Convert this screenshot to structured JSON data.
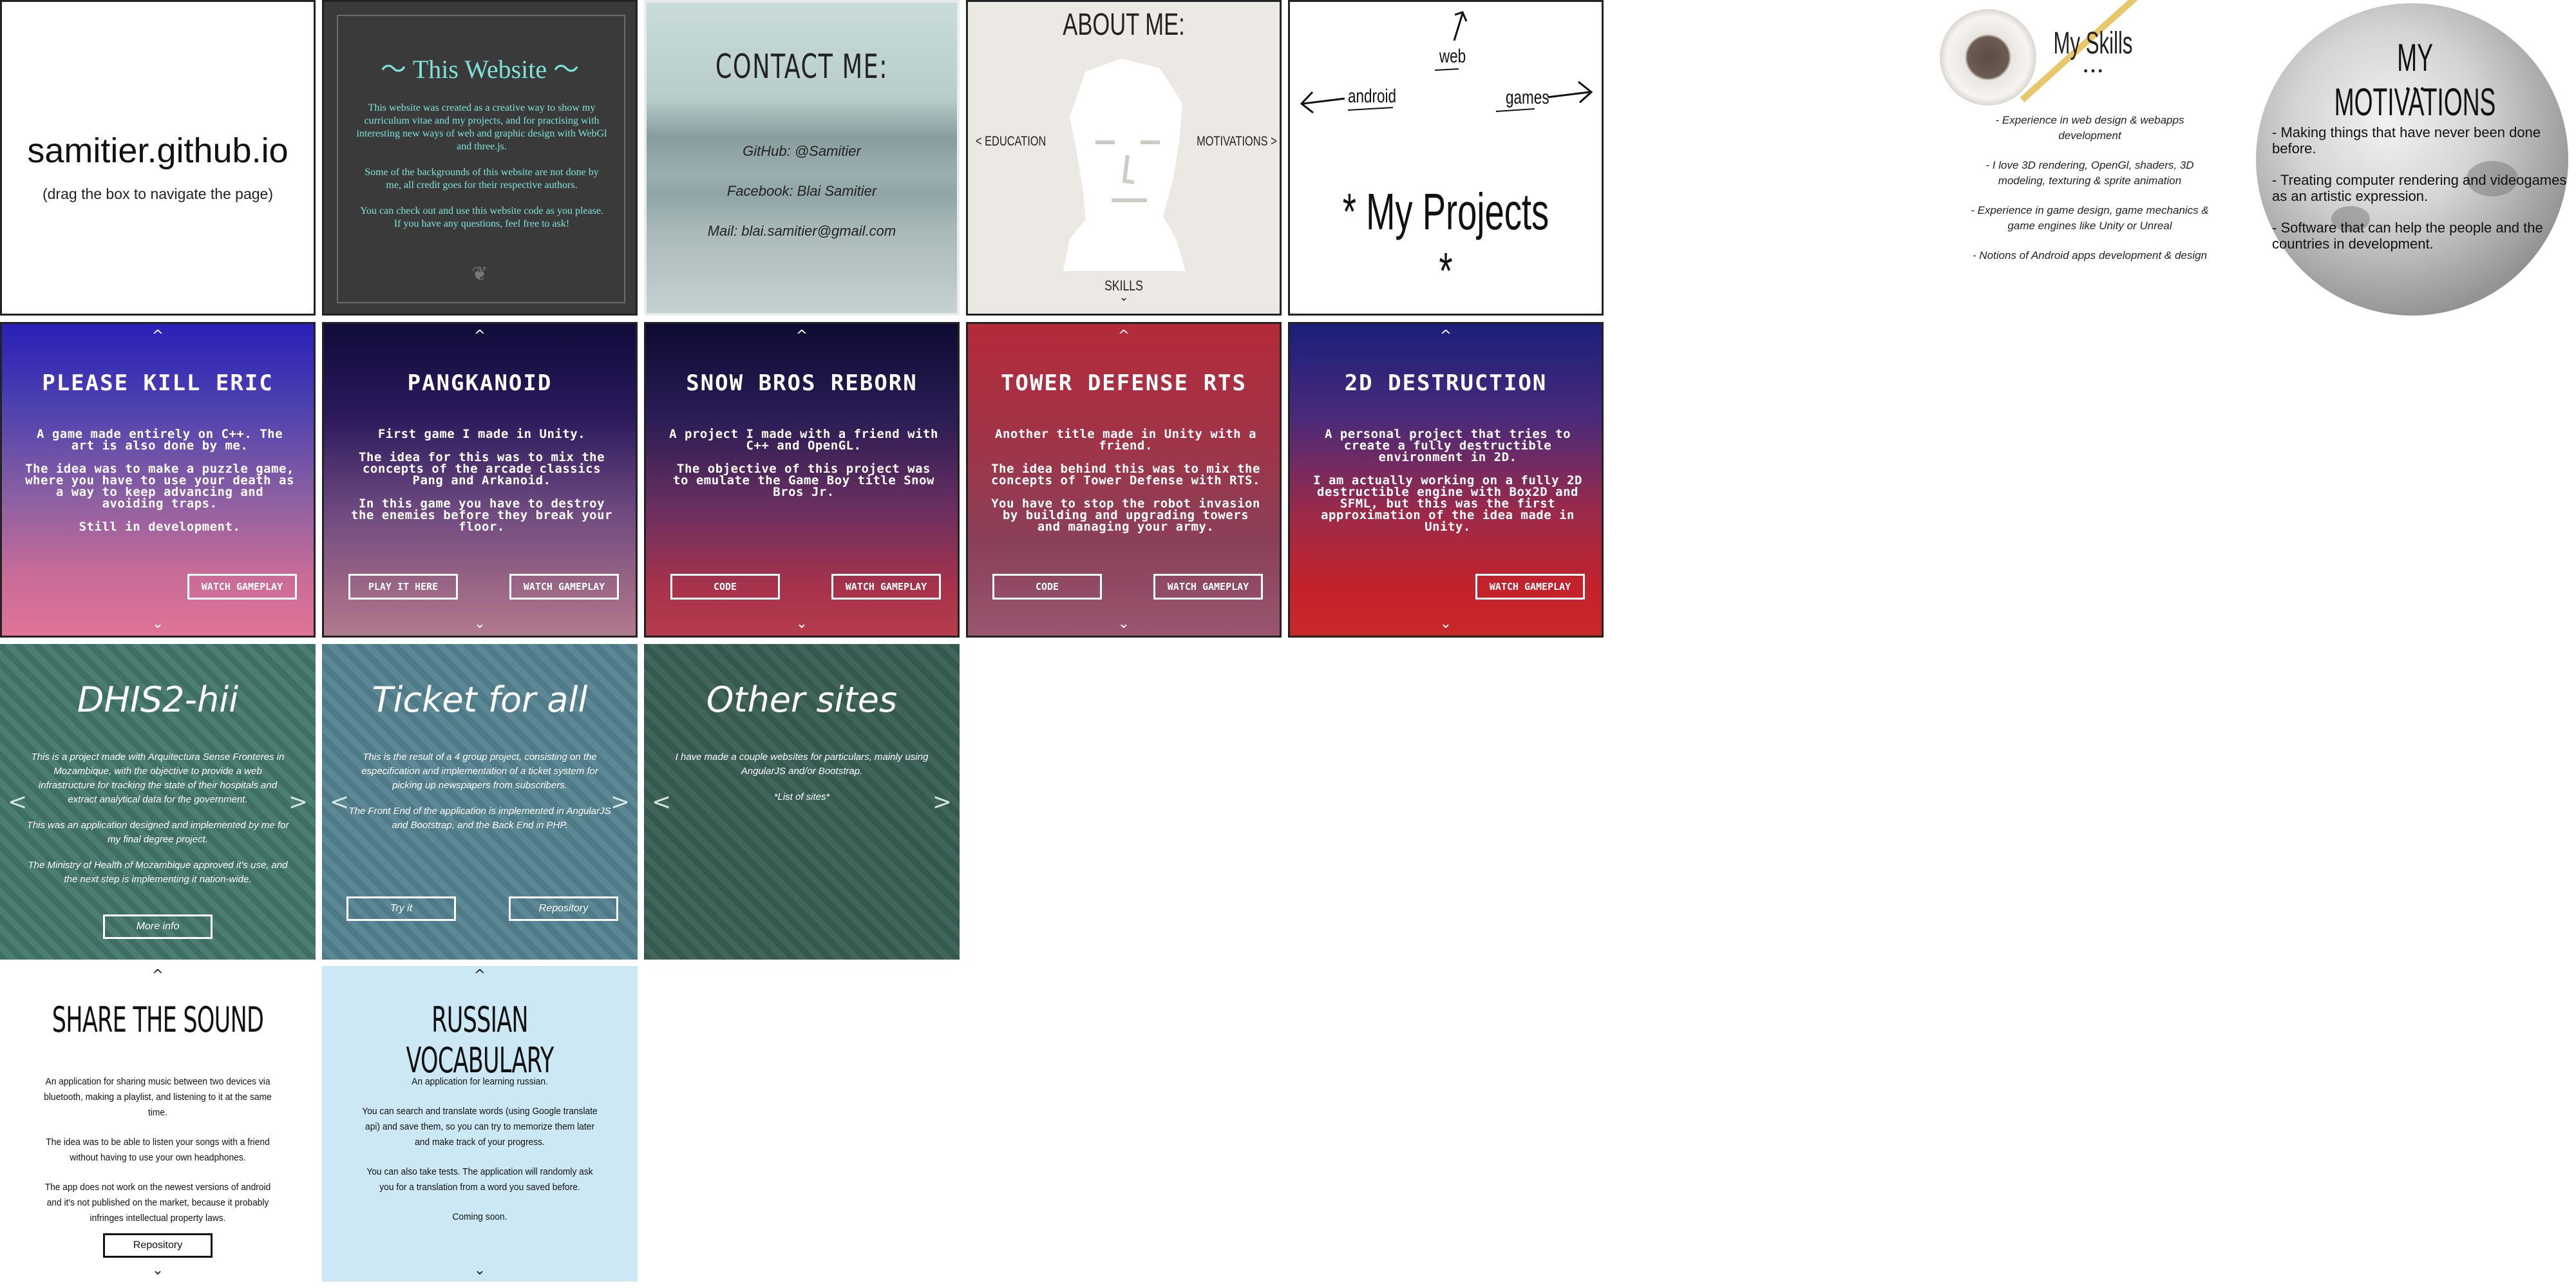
{
  "intro": {
    "title": "samitier.github.io",
    "subtitle": "(drag the box to navigate the page)"
  },
  "this_website": {
    "title": "This Website",
    "paragraphs": [
      "This website was created as a creative way to show my curriculum vitae and my projects, and for practising with interesting new ways of web and graphic design with WebGl and three.js.",
      "Some of the backgrounds of this website are not done by me, all credit goes for their respective authors.",
      "You can check out and use this website code as you please. If you have any questions, feel free to ask!"
    ]
  },
  "contact": {
    "title": "CONTACT ME:",
    "lines": [
      "GitHub: @Samitier",
      "Facebook: Blai Samitier",
      "Mail: blai.samitier@gmail.com"
    ]
  },
  "about": {
    "title": "ABOUT ME:",
    "left_link": "< EDUCATION",
    "right_link": "MOTIVATIONS >",
    "bottom_link": "SKILLS",
    "bottom_chevron": "⌄"
  },
  "projects_nav": {
    "web": "web",
    "android": "android",
    "games": "games",
    "title": "* My Projects *"
  },
  "skills": {
    "title": "My Skills",
    "dots": "• • •",
    "items": [
      "- Experience in web  design & webapps development",
      "- I love 3D rendering, OpenGl, shaders, 3D modeling, texturing & sprite animation",
      "- Experience in game design, game mechanics & game engines like Unity or Unreal",
      "- Notions of Android apps development & design"
    ]
  },
  "motivations": {
    "title": "MY MOTIVATIONS",
    "dots": "• • •",
    "items": [
      "- Making things that have never been done before.",
      "- Treating computer rendering and videogames as an artistic expression.",
      "- Software that can help the people and the countries in development."
    ]
  },
  "arrows": {
    "up": "^",
    "down": "⌄",
    "left": "<",
    "right": ">"
  },
  "games": [
    {
      "title": "PLEASE KILL ERIC",
      "paragraphs": [
        "A game made entirely on C++. The art is also done by me.",
        "The idea was to make a puzzle game, where you have to use your death as a way to keep advancing and avoiding traps.",
        "Still in development."
      ],
      "buttons": [
        "WATCH GAMEPLAY"
      ]
    },
    {
      "title": "PANGKANOID",
      "paragraphs": [
        "First game I made in Unity.",
        "The idea for this was to mix the concepts of the arcade classics Pang and Arkanoid.",
        "In this game you have to destroy the enemies before they break your floor."
      ],
      "buttons": [
        "PLAY IT HERE",
        "WATCH GAMEPLAY"
      ]
    },
    {
      "title": "SNOW BROS REBORN",
      "paragraphs": [
        "A project I made with a friend with C++ and OpenGL.",
        "The objective of this project was to emulate the Game Boy title Snow Bros Jr."
      ],
      "buttons": [
        "CODE",
        "WATCH GAMEPLAY"
      ]
    },
    {
      "title": "TOWER DEFENSE RTS",
      "paragraphs": [
        "Another title made in Unity with a friend.",
        "The idea behind this was to mix the concepts of Tower Defense with RTS.",
        "You have to stop the robot invasion by building and upgrading towers and managing your army."
      ],
      "buttons": [
        "CODE",
        "WATCH GAMEPLAY"
      ]
    },
    {
      "title": "2D DESTRUCTION",
      "paragraphs": [
        "A personal project that tries to create a fully destructible environment in 2D.",
        "I am actually working on a fully 2D destructible engine with Box2D and SFML, but this was the first approximation of the idea made in Unity."
      ],
      "buttons": [
        "WATCH GAMEPLAY"
      ]
    }
  ],
  "webs": [
    {
      "title": "DHIS2-hii",
      "paragraphs": [
        "This is a project made with Arquitectura Sense Fronteres in Mozambique, with the objective to provide a web infrastructure for tracking the state of their hospitals and extract analytical data for the government.",
        "This was an application designed and implemented by me for my final degree project.",
        "The Ministry of Health of Mozambique approved it's use, and the next step is implementing it nation-wide."
      ],
      "buttons": [
        "More info"
      ]
    },
    {
      "title": "Ticket for all",
      "paragraphs": [
        "This is the result of a 4 group project, consisting on the especification and implementation of a ticket system for picking up newspapers from subscribers.",
        "The Front End of the application is implemented in AngularJS and Bootstrap, and the Back End in PHP."
      ],
      "buttons": [
        "Try it",
        "Repository"
      ]
    },
    {
      "title": "Other sites",
      "paragraphs": [
        "I have made a couple websites for particulars, mainly using AngularJS and/or Bootstrap.",
        "*List of  sites*"
      ],
      "buttons": []
    }
  ],
  "apps": [
    {
      "title": "SHARE THE SOUND",
      "paragraphs": [
        "An application for sharing music between two devices via bluetooth, making a playlist, and listening to it at the same time.",
        "The idea was to be able to listen your songs with a friend without having to use your own headphones.",
        "The app does not work on the newest versions of android and it's not published on the market, because it probably infringes intellectual property laws."
      ],
      "buttons": [
        "Repository"
      ]
    },
    {
      "title": "RUSSIAN VOCABULARY",
      "paragraphs": [
        "An application for learning russian.",
        "You can search and translate words (using Google translate api) and save them, so you can try to memorize them later and make track of your progress.",
        "You can also take tests. The application will randomly ask you for a translation from a word you saved before.",
        "Coming soon."
      ],
      "buttons": []
    }
  ]
}
